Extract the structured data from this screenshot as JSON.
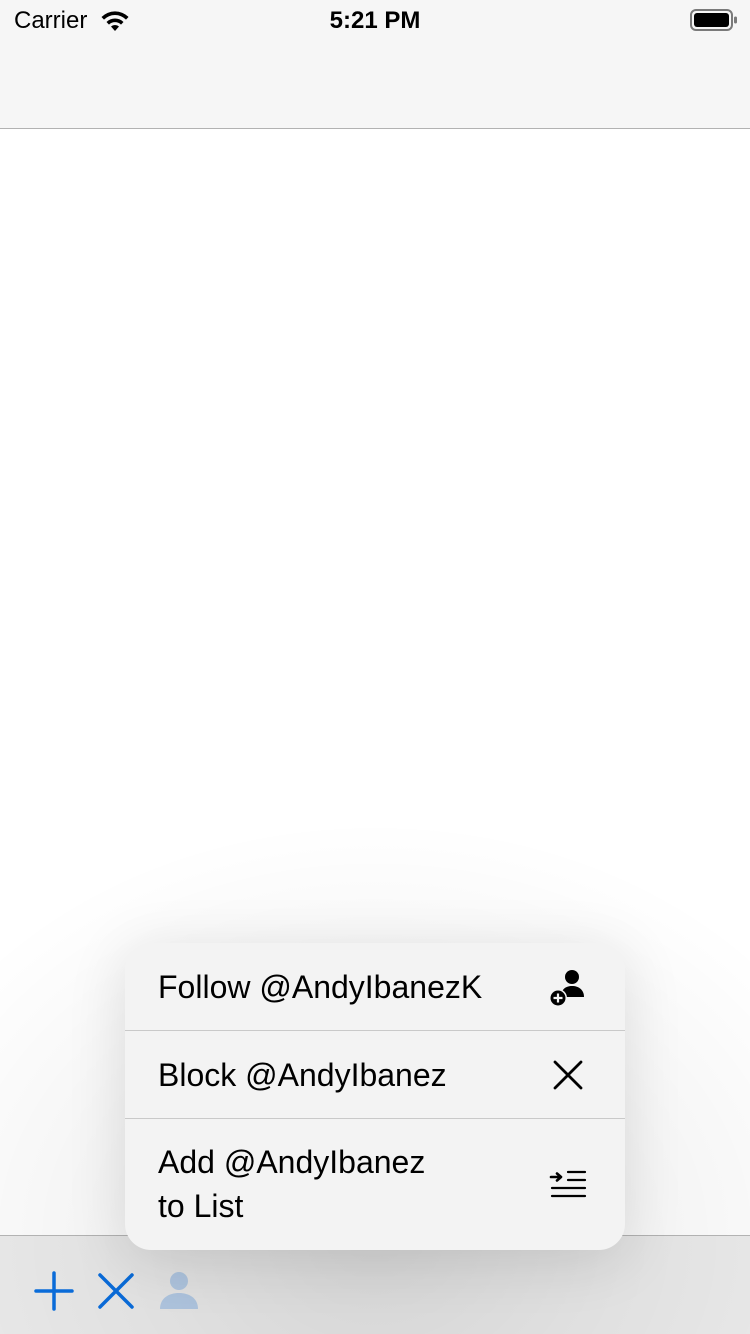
{
  "status_bar": {
    "carrier": "Carrier",
    "time": "5:21 PM",
    "wifi_icon": "wifi-icon",
    "battery_icon": "battery-icon"
  },
  "toolbar": {
    "items": [
      {
        "icon": "plus-icon",
        "state": "enabled"
      },
      {
        "icon": "close-icon",
        "state": "enabled"
      },
      {
        "icon": "person-icon",
        "state": "highlighted"
      }
    ],
    "tint_color": "#0a6fe0",
    "highlight_color": "#b6cde8"
  },
  "context_menu": {
    "items": [
      {
        "label": "Follow @AndyIbanezK",
        "icon": "person-add-icon"
      },
      {
        "label": "Block @AndyIbanez",
        "icon": "close-icon"
      },
      {
        "label_line1": "Add @AndyIbanez",
        "label_line2": "to List",
        "icon": "list-add-icon"
      }
    ]
  }
}
